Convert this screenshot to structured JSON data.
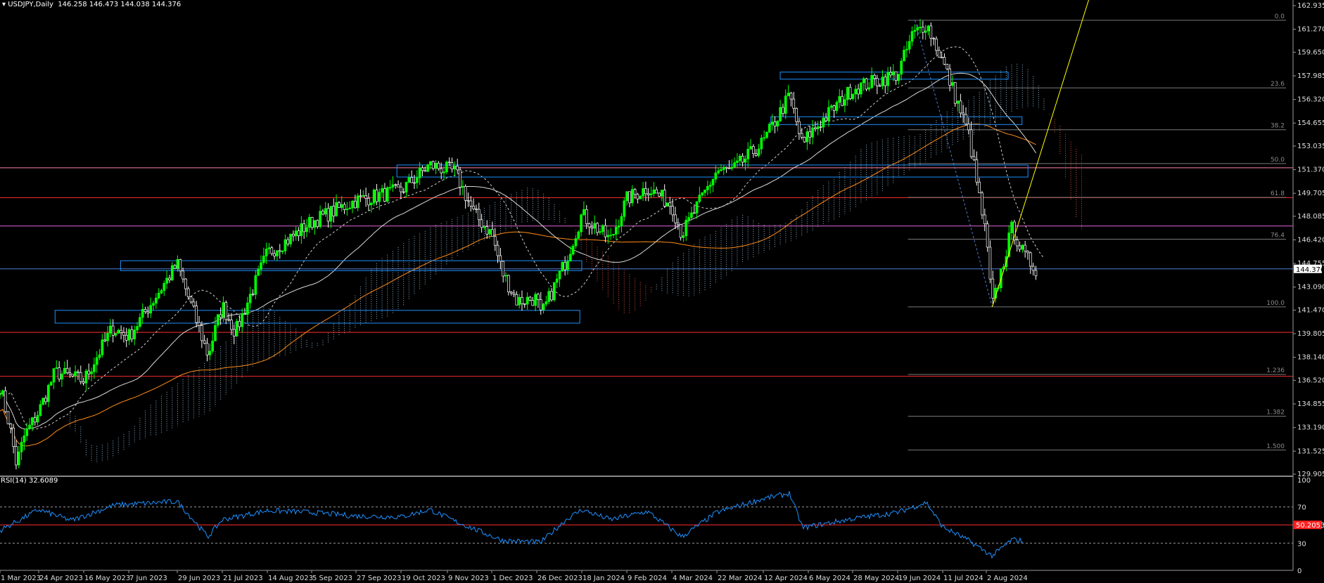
{
  "header": {
    "symbol": "USDJPY,Daily",
    "ohlc": "146.258 146.473 144.038 144.376"
  },
  "rsi_header": "RSI(14) 32.6089",
  "colors": {
    "background": "#000000",
    "bull": "#00ff00",
    "bear": "#ffffff",
    "cloud_bull": "#9fd1f5",
    "cloud_bear": "#ff6347",
    "rect": "#1e90ff",
    "red_line": "#ff2d2d",
    "pink_line": "#ff7fa8",
    "magenta_line": "#e366d9",
    "blue_line": "#4f7fd4",
    "ma_white": "#d8d8d8",
    "ma_orange": "#ff8c1a",
    "trend": "#ffff00",
    "rsi_line": "#1e90ff",
    "price_tag_bg": "#ffffff",
    "rsi_tag_bg": "#ff2020"
  },
  "chart_data": [
    {
      "type": "candlestick",
      "title": "USDJPY,Daily",
      "ylim": [
        129.905,
        162.935
      ],
      "y_ticks": [
        "162.935",
        "161.270",
        "159.650",
        "157.985",
        "156.320",
        "154.655",
        "153.035",
        "151.370",
        "149.705",
        "148.085",
        "146.420",
        "144.755",
        "143.090",
        "141.470",
        "139.805",
        "138.140",
        "136.520",
        "134.855",
        "133.190",
        "131.525",
        "129.905"
      ],
      "x_labels": [
        "1 Mar 2023",
        "24 Apr 2023",
        "16 May 2023",
        "7 Jun 2023",
        "29 Jun 2023",
        "21 Jul 2023",
        "14 Aug 2023",
        "5 Sep 2023",
        "27 Sep 2023",
        "19 Oct 2023",
        "9 Nov 2023",
        "1 Dec 2023",
        "26 Dec 2023",
        "18 Jan 2024",
        "9 Feb 2024",
        "4 Mar 2024",
        "22 Mar 2024",
        "12 Apr 2024",
        "6 May 2024",
        "28 May 2024",
        "19 Jun 2024",
        "11 Jul 2024",
        "2 Aug 2024"
      ],
      "current_price": "144.376",
      "close_path": [
        [
          "1 Mar 2023",
          136.1
        ],
        [
          "15 Mar 2023",
          133.2
        ],
        [
          "24 Mar 2023",
          130.6
        ],
        [
          "4 Apr 2023",
          132.6
        ],
        [
          "24 Apr 2023",
          134.3
        ],
        [
          "2 May 2023",
          137.1
        ],
        [
          "16 May 2023",
          136.5
        ],
        [
          "30 May 2023",
          140.2
        ],
        [
          "7 Jun 2023",
          139.6
        ],
        [
          "29 Jun 2023",
          144.7
        ],
        [
          "14 Jul 2023",
          138.3
        ],
        [
          "21 Jul 2023",
          141.8
        ],
        [
          "28 Jul 2023",
          139.9
        ],
        [
          "14 Aug 2023",
          145.5
        ],
        [
          "25 Aug 2023",
          146.5
        ],
        [
          "5 Sep 2023",
          147.7
        ],
        [
          "27 Sep 2023",
          149.2
        ],
        [
          "19 Oct 2023",
          149.9
        ],
        [
          "1 Nov 2023",
          151.7
        ],
        [
          "13 Nov 2023",
          151.2
        ],
        [
          "22 Nov 2023",
          148.3
        ],
        [
          "1 Dec 2023",
          146.8
        ],
        [
          "7 Dec 2023",
          144.1
        ],
        [
          "15 Dec 2023",
          142.1
        ],
        [
          "26 Dec 2023",
          142.3
        ],
        [
          "28 Dec 2023",
          141.0
        ],
        [
          "10 Jan 2024",
          145.0
        ],
        [
          "18 Jan 2024",
          148.2
        ],
        [
          "1 Feb 2024",
          146.4
        ],
        [
          "9 Feb 2024",
          149.3
        ],
        [
          "20 Feb 2024",
          150.1
        ],
        [
          "4 Mar 2024",
          148.9
        ],
        [
          "8 Mar 2024",
          146.8
        ],
        [
          "22 Mar 2024",
          151.3
        ],
        [
          "29 Mar 2024",
          151.3
        ],
        [
          "12 Apr 2024",
          153.3
        ],
        [
          "26 Apr 2024",
          156.6
        ],
        [
          "3 May 2024",
          153.0
        ],
        [
          "6 May 2024",
          153.8
        ],
        [
          "28 May 2024",
          157.1
        ],
        [
          "19 Jun 2024",
          158.1
        ],
        [
          "26 Jun 2024",
          160.8
        ],
        [
          "3 Jul 2024",
          161.7
        ],
        [
          "11 Jul 2024",
          159.0
        ],
        [
          "24 Jul 2024",
          153.9
        ],
        [
          "2 Aug 2024",
          146.5
        ],
        [
          "5 Aug 2024",
          141.7
        ],
        [
          "15 Aug 2024",
          147.3
        ],
        [
          "21 Aug 2024",
          145.3
        ],
        [
          "27 Aug 2024",
          144.4
        ]
      ],
      "fibonacci": {
        "levels": [
          "0.0",
          "23.6",
          "38.2",
          "50.0",
          "61.8",
          "76.4",
          "100.0",
          "1.236",
          "1.382",
          "1.500"
        ],
        "high": 161.9,
        "low": 141.7
      },
      "horizontal_lines": {
        "pink": 151.5,
        "red": [
          149.4,
          139.9,
          136.8
        ],
        "magenta": 147.4,
        "blue": 144.376
      },
      "rectangles": [
        {
          "from": "3 Jun 2023",
          "to": "18 Jan 2024",
          "top": 144.95,
          "bottom": 144.25
        },
        {
          "from": "2 May 2023",
          "to": "17 Jan 2024",
          "top": 141.45,
          "bottom": 140.55
        },
        {
          "from": "17 Oct 2023",
          "to": "23 Aug 2024",
          "top": 151.7,
          "bottom": 150.85
        },
        {
          "from": "16 Apr 2024",
          "to": "20 Aug 2024",
          "top": 155.1,
          "bottom": 154.55
        },
        {
          "from": "21 Apr 2024",
          "to": "13 Aug 2024",
          "top": 158.25,
          "bottom": 157.75
        }
      ],
      "trendline": {
        "from_date": "5 Aug 2024",
        "from_price": 141.7,
        "to_date": "23 Sep 2024",
        "to_price": 163.5
      }
    },
    {
      "type": "line",
      "title": "RSI(14) 32.6089",
      "ylim": [
        0,
        100
      ],
      "y_ticks": [
        "100",
        "70",
        "30",
        "0"
      ],
      "levels": [
        70,
        30
      ],
      "red_level_value": "50.2053",
      "red_level": 50.2,
      "path": [
        [
          "1 Mar 2023",
          44
        ],
        [
          "24 Apr 2023",
          67
        ],
        [
          "10 May 2023",
          55
        ],
        [
          "31 May 2023",
          72
        ],
        [
          "29 Jun 2023",
          76
        ],
        [
          "14 Jul 2023",
          37
        ],
        [
          "21 Jul 2023",
          56
        ],
        [
          "14 Aug 2023",
          66
        ],
        [
          "5 Sep 2023",
          64
        ],
        [
          "27 Sep 2023",
          60
        ],
        [
          "19 Oct 2023",
          59
        ],
        [
          "1 Nov 2023",
          67
        ],
        [
          "13 Nov 2023",
          54
        ],
        [
          "7 Dec 2023",
          33
        ],
        [
          "28 Dec 2023",
          31
        ],
        [
          "10 Jan 2024",
          56
        ],
        [
          "18 Jan 2024",
          67
        ],
        [
          "1 Feb 2024",
          56
        ],
        [
          "20 Feb 2024",
          65
        ],
        [
          "8 Mar 2024",
          37
        ],
        [
          "22 Mar 2024",
          64
        ],
        [
          "12 Apr 2024",
          79
        ],
        [
          "26 Apr 2024",
          85
        ],
        [
          "3 May 2024",
          47
        ],
        [
          "28 May 2024",
          57
        ],
        [
          "19 Jun 2024",
          64
        ],
        [
          "3 Jul 2024",
          75
        ],
        [
          "11 Jul 2024",
          48
        ],
        [
          "24 Jul 2024",
          33
        ],
        [
          "5 Aug 2024",
          16
        ],
        [
          "15 Aug 2024",
          34
        ],
        [
          "21 Aug 2024",
          32.6
        ]
      ]
    }
  ]
}
